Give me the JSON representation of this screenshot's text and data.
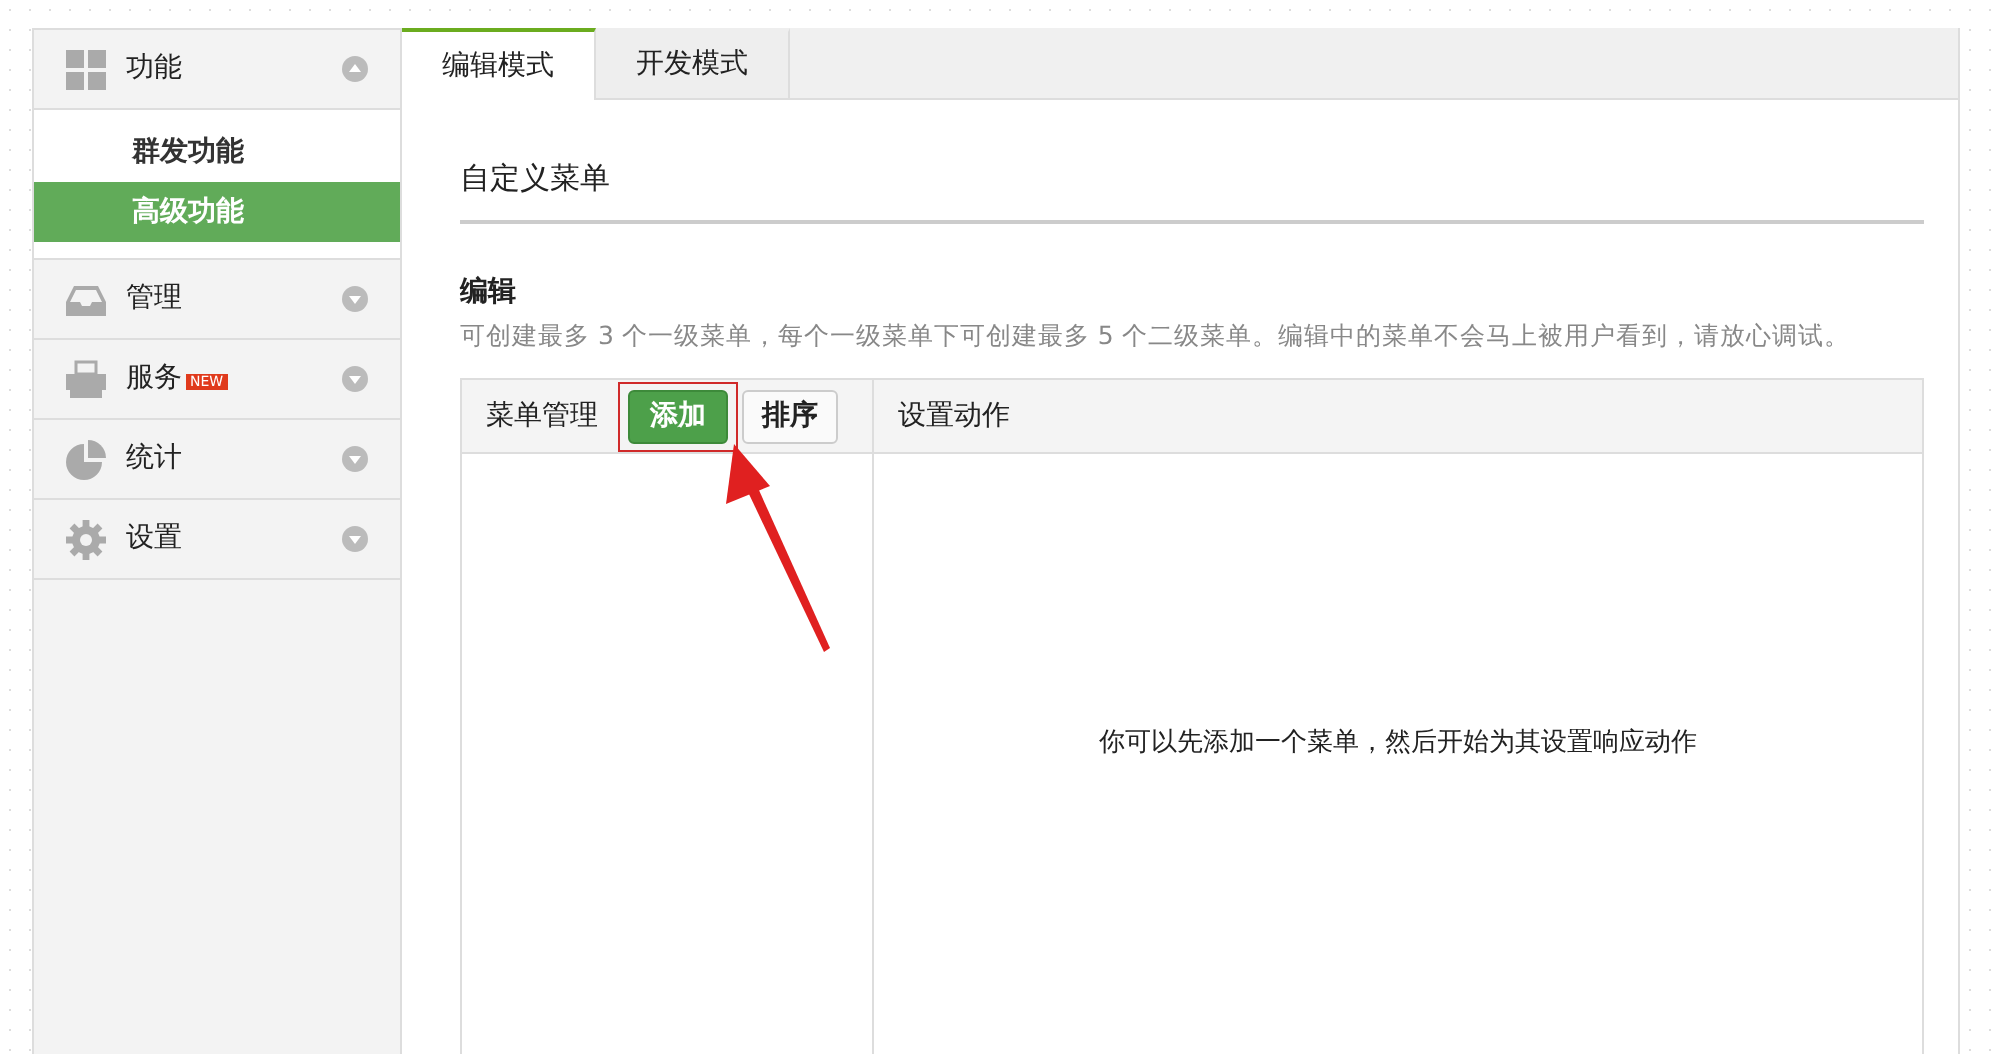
{
  "sidebar": {
    "items": [
      {
        "label": "功能",
        "expanded": true,
        "children": [
          {
            "label": "群发功能",
            "selected": false
          },
          {
            "label": "高级功能",
            "selected": true
          }
        ]
      },
      {
        "label": "管理",
        "expanded": false
      },
      {
        "label": "服务",
        "badge": "NEW",
        "expanded": false
      },
      {
        "label": "统计",
        "expanded": false
      },
      {
        "label": "设置",
        "expanded": false
      }
    ]
  },
  "tabs": [
    {
      "label": "编辑模式",
      "selected": true
    },
    {
      "label": "开发模式",
      "selected": false
    }
  ],
  "section_title": "自定义菜单",
  "edit": {
    "heading": "编辑",
    "hint": "可创建最多 3 个一级菜单，每个一级菜单下可创建最多 5 个二级菜单。编辑中的菜单不会马上被用户看到，请放心调试。"
  },
  "panel": {
    "left_title": "菜单管理",
    "buttons": [
      {
        "label": "添加",
        "kind": "primary",
        "highlighted": true
      },
      {
        "label": "排序",
        "kind": "default",
        "highlighted": false
      }
    ],
    "right_title": "设置动作",
    "empty_message": "你可以先添加一个菜单，然后开始为其设置响应动作"
  }
}
